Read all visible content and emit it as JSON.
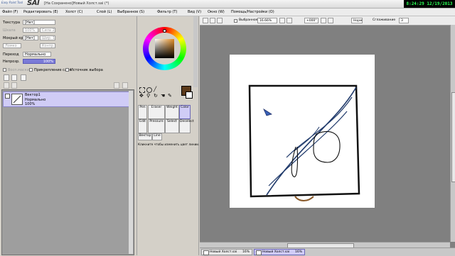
{
  "window": {
    "logo_small": "Easy Paint Tool",
    "logo_big": "SAI",
    "title": "[На Сохранено]Новый Холст.sai (*)",
    "clock_time": "8:24:29",
    "clock_date": "12/19/2013"
  },
  "menu": [
    "Файл (F)",
    "Редактировать (E)",
    "Холст (C)",
    "Слой (L)",
    "Выбранное (S)",
    "Фильтр (T)",
    "Вид (V)",
    "Окно (W)",
    "Помощь/Настройки (O)"
  ],
  "properties": {
    "texture_label": "Текстура",
    "texture_value": "[Нет]",
    "scale_label": "Шкала",
    "scale_value": "100%",
    "scale2_value": "Сила 20",
    "effect_label": "Мокрый край",
    "effect_value": "[Нет]",
    "effect2_value": "Шир. 10",
    "effect3_label": "Ломко",
    "effect3_value": "Ломко",
    "effect4_value": "Контр. 10",
    "blend_label": "Переход",
    "blend_value": "Нормально",
    "opacity_label": "Непрозр.",
    "opacity_value": "100%",
    "cb1_label": "Восп.маски",
    "cb2_label": "Прикрепление слоя",
    "cb3_label": "Источник выбора"
  },
  "layers": [
    {
      "name": "Вектор1",
      "mode": "Нормально",
      "opacity": "100%"
    }
  ],
  "tools": {
    "tabs_row1": [
      "Pen",
      "Eraser",
      "Weight",
      "Color"
    ],
    "tabs_row2": [
      "Edit",
      "Pressure",
      "Select",
      "Deselect"
    ],
    "tabs_row3": [
      "Вектор",
      "Line"
    ],
    "hint": "Кликните чтобы изменить цвет линии.",
    "primary_color": "#5c3a1a",
    "secondary_color": "#ffffff"
  },
  "canvas_toolbar": {
    "selection_label": "Выбранное",
    "zoom": "16.66%",
    "angle": "+000°",
    "mode": "Норм",
    "stabilizer_label": "Сглаживание",
    "stabilizer_value": "3"
  },
  "tabs": [
    {
      "name": "Новый Холст.sai",
      "zoom": "16%"
    },
    {
      "name": "Новый Холст.sai",
      "zoom": "16%"
    }
  ]
}
